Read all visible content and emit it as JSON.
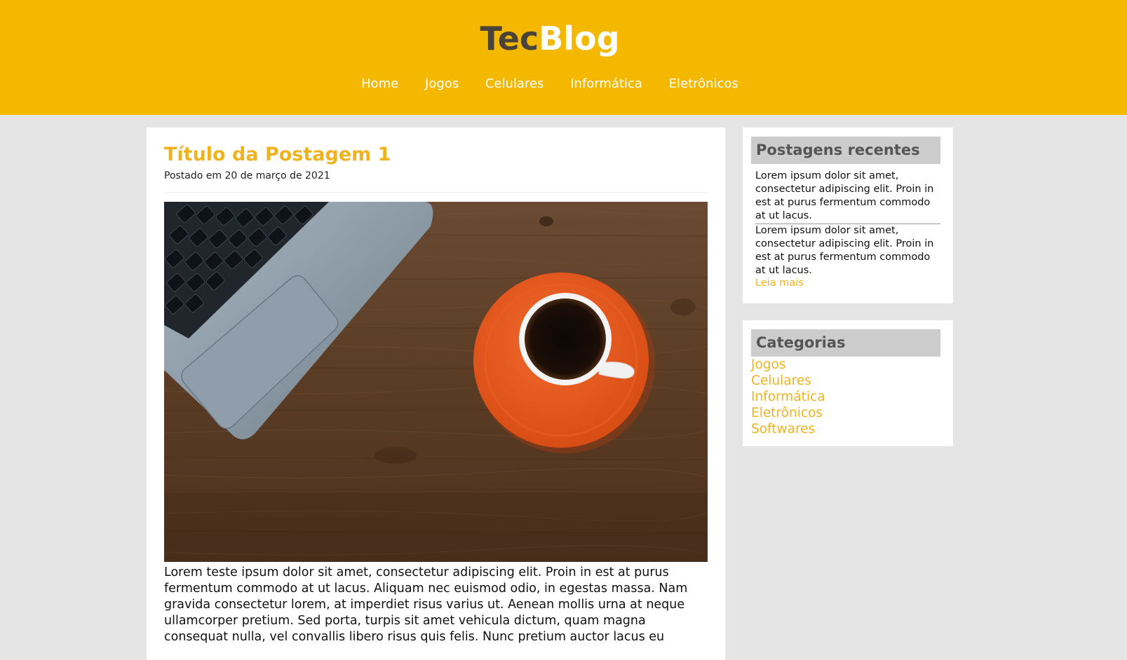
{
  "header": {
    "logo_part1": "Tec",
    "logo_part2": "Blog",
    "nav": [
      "Home",
      "Jogos",
      "Celulares",
      "Informática",
      "Eletrônicos"
    ],
    "background_color": "#f5b800"
  },
  "post": {
    "title": "Título da Postagem 1",
    "date": "Postado em 20 de março de 2021",
    "image": "laptop-and-coffee-cup-photo",
    "body": "Lorem teste ipsum dolor sit amet, consectetur adipiscing elit. Proin in est at purus fermentum commodo at ut lacus. Aliquam nec euismod odio, in egestas massa. Nam gravida consectetur lorem, at imperdiet risus varius ut. Aenean mollis urna at neque ullamcorper pretium. Sed porta, turpis sit amet vehicula dictum, quam magna consequat nulla, vel convallis libero risus quis felis. Nunc pretium auctor lacus eu"
  },
  "sidebar": {
    "recent": {
      "title": "Postagens recentes",
      "items": [
        "Lorem ipsum dolor sit amet, consectetur adipiscing elit. Proin in est at purus fermentum commodo at ut lacus.",
        "Lorem ipsum dolor sit amet, consectetur adipiscing elit. Proin in est at purus fermentum commodo at ut lacus."
      ],
      "read_more": "Leia mais"
    },
    "categories": {
      "title": "Categorias",
      "items": [
        "Jogos",
        "Celulares",
        "Informática",
        "Eletrônicos",
        "Softwares"
      ]
    }
  },
  "colors": {
    "accent": "#f0b320",
    "page_background": "#e5e5e5"
  }
}
